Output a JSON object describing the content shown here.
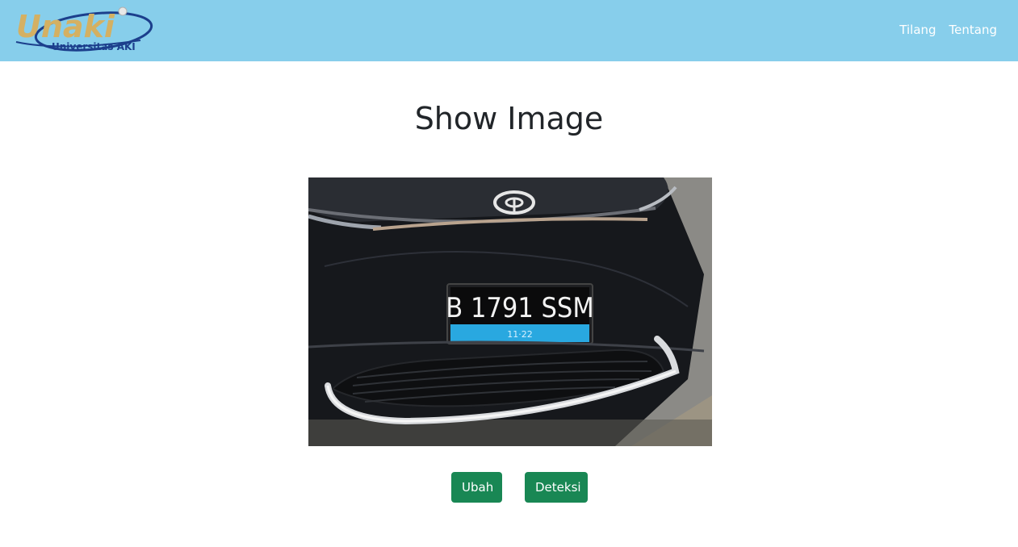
{
  "header": {
    "logo": {
      "wordmark": "Unaki",
      "subtitle": "Universitas AKI",
      "colors": {
        "wordmark": "#d4b062",
        "swoosh": "#1c3f8c"
      }
    },
    "nav": [
      {
        "label": "Tilang"
      },
      {
        "label": "Tentang"
      }
    ]
  },
  "main": {
    "title": "Show Image",
    "image": {
      "plate_text": "B 1791 SSM",
      "plate_subtext": "11·22"
    },
    "buttons": {
      "change_label": "Ubah",
      "detect_label": "Deteksi"
    }
  },
  "colors": {
    "navbar": "#87ceeb",
    "button": "#198754",
    "title": "#212529"
  }
}
